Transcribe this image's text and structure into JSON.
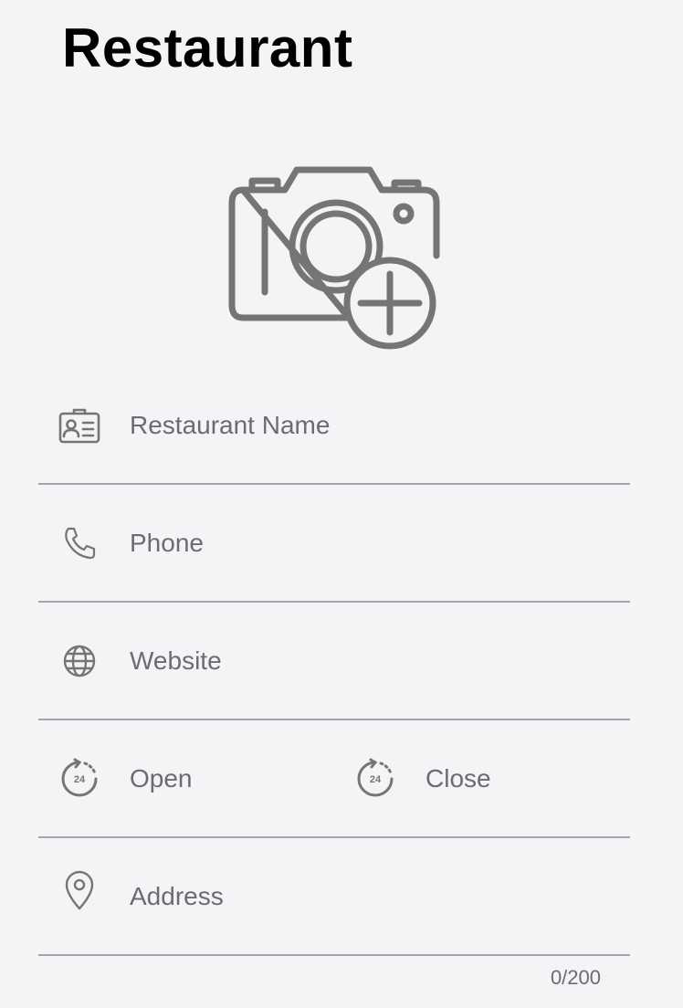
{
  "header": {
    "title": "Restaurant"
  },
  "photo": {
    "icon": "camera-add-icon"
  },
  "fields": {
    "name": {
      "placeholder": "Restaurant Name",
      "icon": "id-card-icon"
    },
    "phone": {
      "placeholder": "Phone",
      "icon": "phone-icon"
    },
    "website": {
      "placeholder": "Website",
      "icon": "globe-icon"
    },
    "open": {
      "placeholder": "Open",
      "icon": "clock-24-icon"
    },
    "close": {
      "placeholder": "Close",
      "icon": "clock-24-icon"
    },
    "address": {
      "placeholder": "Address",
      "icon": "location-pin-icon",
      "counter": "0/200"
    }
  },
  "colors": {
    "icon": "#757575",
    "divider": "#a6a6aa",
    "placeholder": "#6c6c70"
  }
}
